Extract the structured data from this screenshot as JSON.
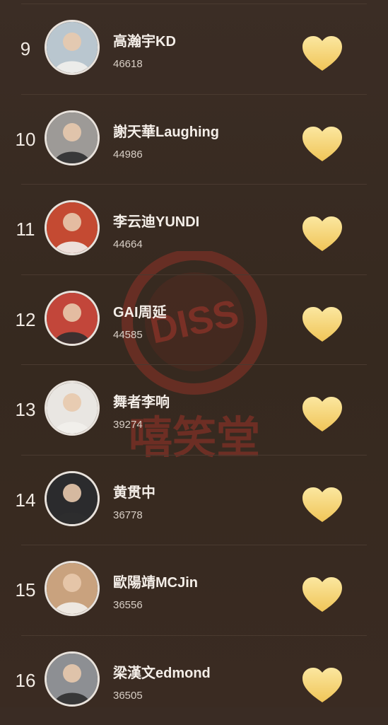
{
  "watermark": {
    "badge_text": "DISS",
    "sub_text": "嘻笑堂",
    "color": "#b3362b"
  },
  "colors": {
    "heart_top": "#fbe7a0",
    "heart_bottom": "#f2c65a",
    "background": "#3a2c24"
  },
  "ranking": [
    {
      "rank": "9",
      "name": "高瀚宇KD",
      "score": "46618",
      "avatar_tone": "#b9c6cf"
    },
    {
      "rank": "10",
      "name": "謝天華Laughing",
      "score": "44986",
      "avatar_tone": "#9d9a97"
    },
    {
      "rank": "11",
      "name": "李云迪YUNDI",
      "score": "44664",
      "avatar_tone": "#c44a32"
    },
    {
      "rank": "12",
      "name": "GAI周延",
      "score": "44585",
      "avatar_tone": "#c2463a"
    },
    {
      "rank": "13",
      "name": "舞者李响",
      "score": "39274",
      "avatar_tone": "#e9e6e2"
    },
    {
      "rank": "14",
      "name": "黄贯中",
      "score": "36778",
      "avatar_tone": "#2b2b2d"
    },
    {
      "rank": "15",
      "name": "歐陽靖MCJin",
      "score": "36556",
      "avatar_tone": "#c9a27e"
    },
    {
      "rank": "16",
      "name": "梁漢文edmond",
      "score": "36505",
      "avatar_tone": "#8d8f93"
    }
  ]
}
